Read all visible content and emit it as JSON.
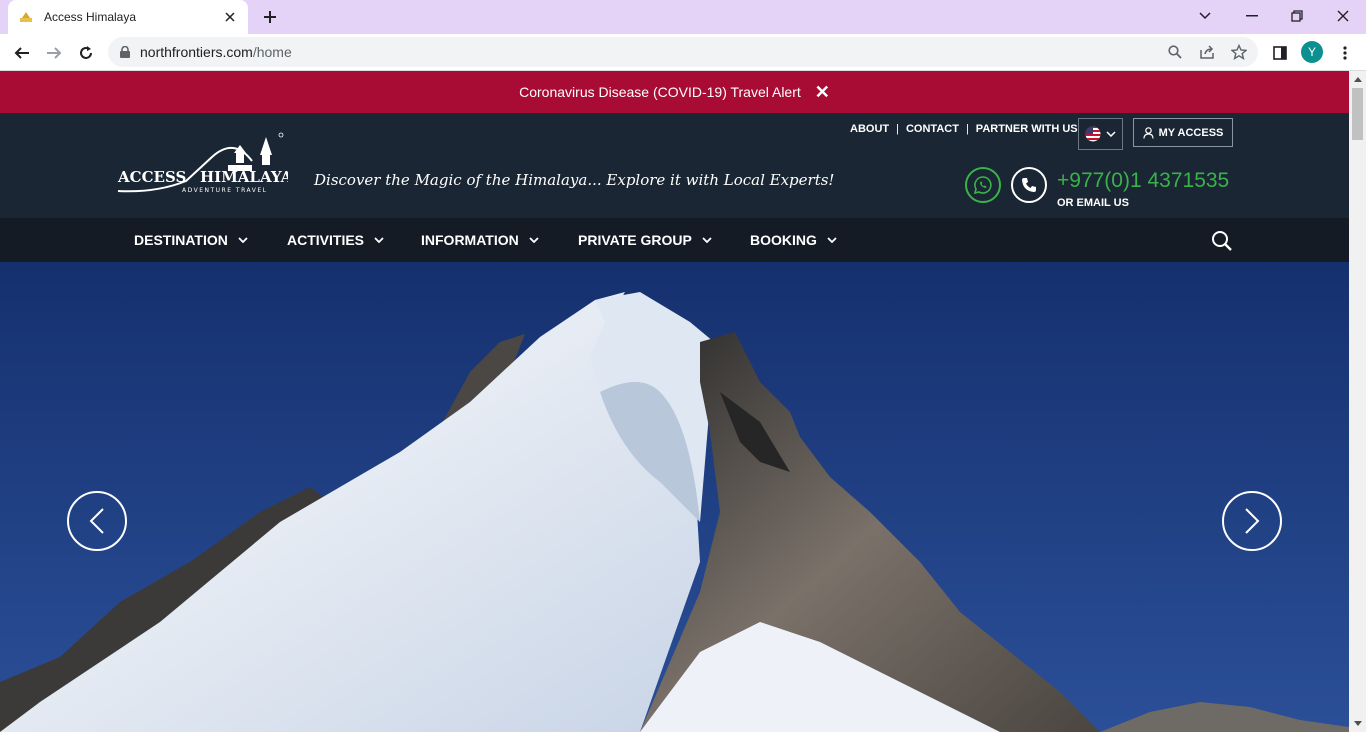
{
  "browser": {
    "tab": {
      "title": "Access Himalaya"
    },
    "url": {
      "host": "northfrontiers.com",
      "path": "/home"
    },
    "profile_initial": "Y"
  },
  "alert": {
    "text": "Coronavirus Disease (COVID-19) Travel Alert",
    "close_symbol": "✕"
  },
  "header": {
    "logo": {
      "line1_left": "ACCESS",
      "line1_right": "HIMALAYA",
      "line2": "ADVENTURE TRAVEL"
    },
    "tagline": "Discover the Magic of the Himalaya... Explore it with Local Experts!",
    "top_links": [
      "ABOUT",
      "CONTACT",
      "PARTNER WITH US"
    ],
    "my_access_label": "MY ACCESS",
    "phone": "+977(0)1 4371535",
    "email_label": "OR EMAIL US"
  },
  "nav": {
    "items": [
      "DESTINATION",
      "ACTIVITIES",
      "INFORMATION",
      "PRIVATE GROUP",
      "BOOKING"
    ]
  },
  "colors": {
    "alert_bg": "#a80c35",
    "header_bg": "#1a2633",
    "nav_bg": "#141b24",
    "accent_green": "#3ab24a",
    "sky": "#1e3e86"
  },
  "icons": [
    "whatsapp-icon",
    "phone-icon",
    "search-icon",
    "user-icon",
    "us-flag-icon",
    "chevron-left-icon",
    "chevron-right-icon"
  ]
}
